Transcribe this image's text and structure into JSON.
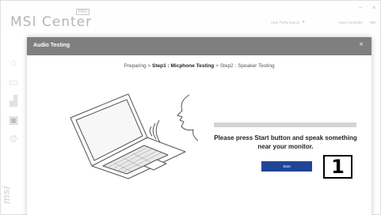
{
  "app": {
    "brand": "MSI Center",
    "brand_badge": "PRO",
    "minimize": "–",
    "close": "×",
    "performance_label": "High Performance",
    "app_controller_label": "Apps Controller",
    "app_controller_value": "ON"
  },
  "sidebar": {
    "icons": [
      "home-icon",
      "monitor-icon",
      "chart-icon",
      "briefcase-icon",
      "gear-icon"
    ],
    "logo_text": "msi"
  },
  "dialog": {
    "title": "Audio Testing",
    "close": "×",
    "breadcrumb": {
      "prefix": "Preparing",
      "sep1": " > ",
      "current": "Step1 : Micphone Testing",
      "sep2": " > ",
      "next": "Step2 : Speaker Testing"
    },
    "progress": 0,
    "instruction": "Please press Start button and speak something near your monitor.",
    "start_button": "Start",
    "step_badge": "1"
  },
  "colors": {
    "header": "#7f7f7f",
    "button": "#1f4597",
    "progress_track": "#d4d4d4"
  }
}
